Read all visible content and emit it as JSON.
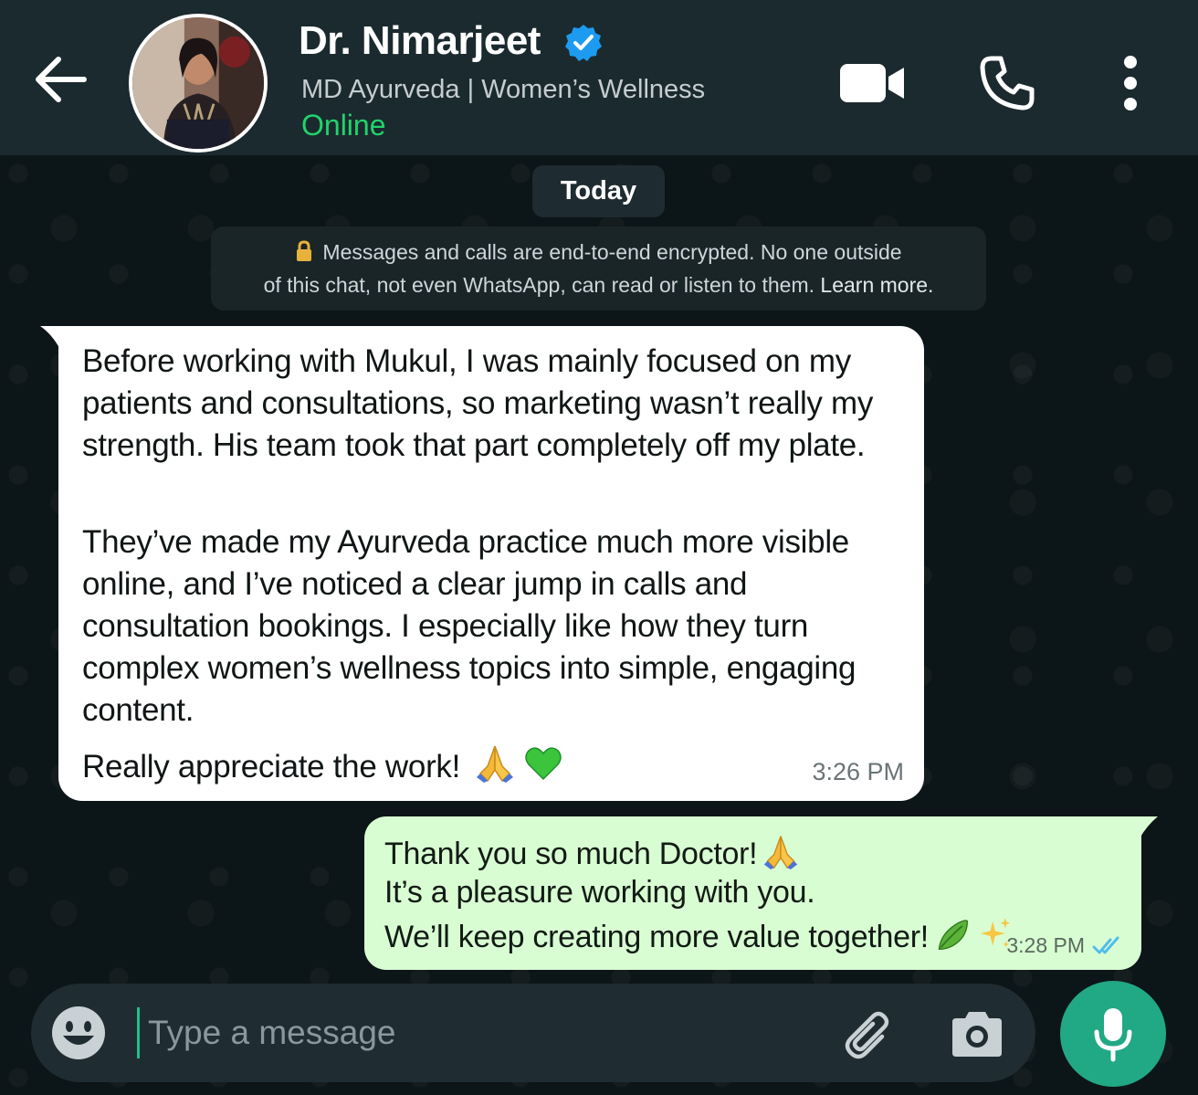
{
  "header": {
    "name": "Dr. Nimarjeet",
    "subtitle": "MD Ayurveda | Women’s Wellness",
    "status": "Online",
    "icons": {
      "back": "arrow-left-icon",
      "verified": "verified-badge-icon",
      "video": "video-camera-icon",
      "phone": "phone-icon",
      "menu": "more-vertical-icon"
    }
  },
  "chat": {
    "date_label": "Today",
    "encryption_notice": {
      "line1": "Messages and calls are end-to-end encrypted. No one outside",
      "line2": "of this chat, not even WhatsApp, can read or listen to them.",
      "learn_more": "Learn more."
    },
    "incoming": {
      "paragraph1": "Before working with Mukul, I was mainly focused on my patients and consultations, so marketing wasn’t really my strength. His team took that part completely off my plate.",
      "paragraph2": "They’ve made my Ayurveda practice much more visible online, and I’ve noticed a clear jump in calls and consultation bookings. I especially like how they turn complex women’s wellness topics into simple, engaging content.",
      "paragraph3": "Really appreciate the work!",
      "emojis": [
        "folded-hands",
        "green-heart"
      ],
      "time": "3:26 PM"
    },
    "outgoing": {
      "line1": "Thank you so much Doctor!",
      "line2": "It’s a pleasure working with you.",
      "line3": "We’ll keep creating more value together!",
      "emojis": [
        "folded-hands",
        "herb",
        "sparkles"
      ],
      "time": "3:28 PM",
      "status": "read"
    }
  },
  "composer": {
    "placeholder": "Type a message",
    "value": "",
    "icons": {
      "emoji": "emoji-icon",
      "attach": "paperclip-icon",
      "camera": "camera-icon",
      "mic": "microphone-icon"
    }
  },
  "colors": {
    "header_bg": "#1b2a2f",
    "online": "#22d36a",
    "outgoing_bubble": "#d9fdd3",
    "incoming_bubble": "#ffffff",
    "accent": "#21a884",
    "read_ticks": "#53bdeb"
  }
}
